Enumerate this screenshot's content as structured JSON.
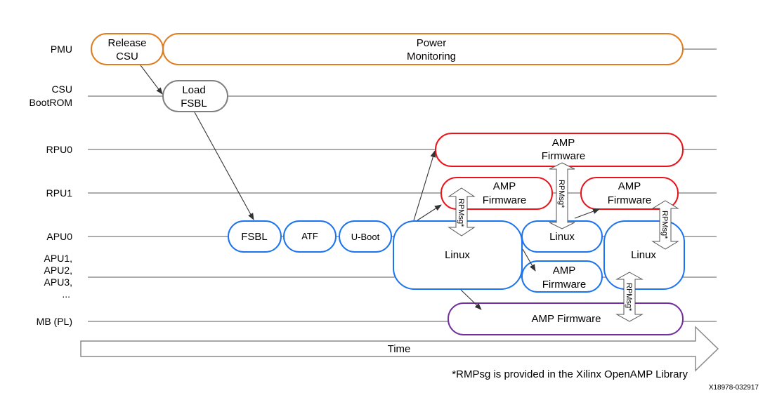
{
  "lanes": {
    "pmu": "PMU",
    "csu": [
      "CSU",
      "BootROM"
    ],
    "rpu0": "RPU0",
    "rpu1": "RPU1",
    "apu0": "APU0",
    "apu_other": [
      "APU1,",
      "APU2,",
      "APU3,",
      "..."
    ],
    "mb": "MB (PL)"
  },
  "boxes": {
    "release_csu": [
      "Release",
      "CSU"
    ],
    "power_monitoring": [
      "Power",
      "Monitoring"
    ],
    "load_fsbl": [
      "Load",
      "FSBL"
    ],
    "fsbl": "FSBL",
    "atf": "ATF",
    "uboot": "U-Boot",
    "linux": "Linux",
    "amp_firmware": [
      "AMP",
      "Firmware"
    ],
    "amp_firmware_single": "AMP Firmware"
  },
  "rpmsg_label": "RPMsg*",
  "time_label": "Time",
  "footnote": "*RMPsg is provided in the Xilinx OpenAMP Library",
  "figure_id": "X18978-032917",
  "colors": {
    "pmu": "#e07b1f",
    "csu": "#808080",
    "apu": "#1a73f0",
    "rpu": "#e8141a",
    "mb": "#7030a0"
  }
}
